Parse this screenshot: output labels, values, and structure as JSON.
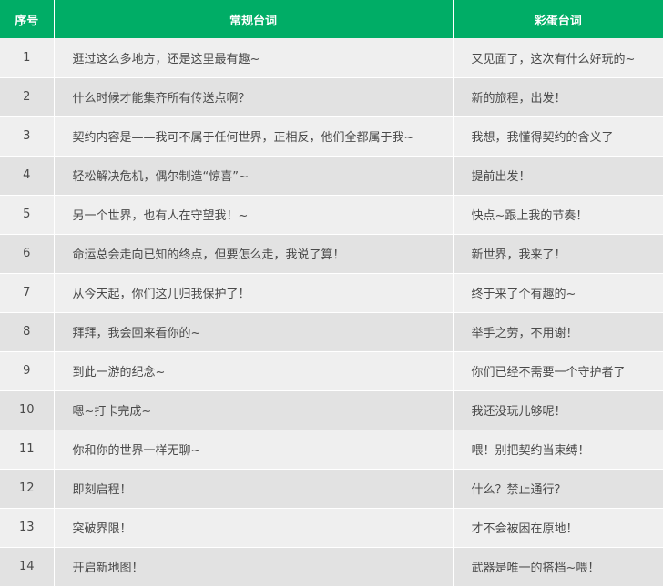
{
  "table": {
    "headers": [
      "序号",
      "常规台词",
      "彩蛋台词"
    ],
    "rows": [
      {
        "num": "1",
        "normal": "逛过这么多地方，还是这里最有趣~",
        "egg": "又见面了，这次有什么好玩的~"
      },
      {
        "num": "2",
        "normal": "什么时候才能集齐所有传送点啊？",
        "egg": "新的旅程，出发！"
      },
      {
        "num": "3",
        "normal": "契约内容是——我可不属于任何世界，正相反，他们全都属于我~",
        "egg": "我想，我懂得契约的含义了"
      },
      {
        "num": "4",
        "normal": "轻松解决危机，偶尔制造“惊喜”~",
        "egg": "提前出发！"
      },
      {
        "num": "5",
        "normal": "另一个世界，也有人在守望我！~",
        "egg": "快点~跟上我的节奏！"
      },
      {
        "num": "6",
        "normal": "命运总会走向已知的终点，但要怎么走，我说了算！",
        "egg": "新世界，我来了！"
      },
      {
        "num": "7",
        "normal": "从今天起，你们这儿归我保护了！",
        "egg": "终于来了个有趣的~"
      },
      {
        "num": "8",
        "normal": "拜拜，我会回来看你的~",
        "egg": "举手之劳，不用谢！"
      },
      {
        "num": "9",
        "normal": "到此一游的纪念~",
        "egg": "你们已经不需要一个守护者了"
      },
      {
        "num": "10",
        "normal": "嗯~打卡完成~",
        "egg": "我还没玩儿够呢！"
      },
      {
        "num": "11",
        "normal": "你和你的世界一样无聊~",
        "egg": "喂！别把契约当束缚！"
      },
      {
        "num": "12",
        "normal": "即刻启程！",
        "egg": "什么？禁止通行？"
      },
      {
        "num": "13",
        "normal": "突破界限！",
        "egg": "才不会被困在原地！"
      },
      {
        "num": "14",
        "normal": "开启新地图！",
        "egg": "武器是唯一的搭档~喂！"
      }
    ]
  }
}
